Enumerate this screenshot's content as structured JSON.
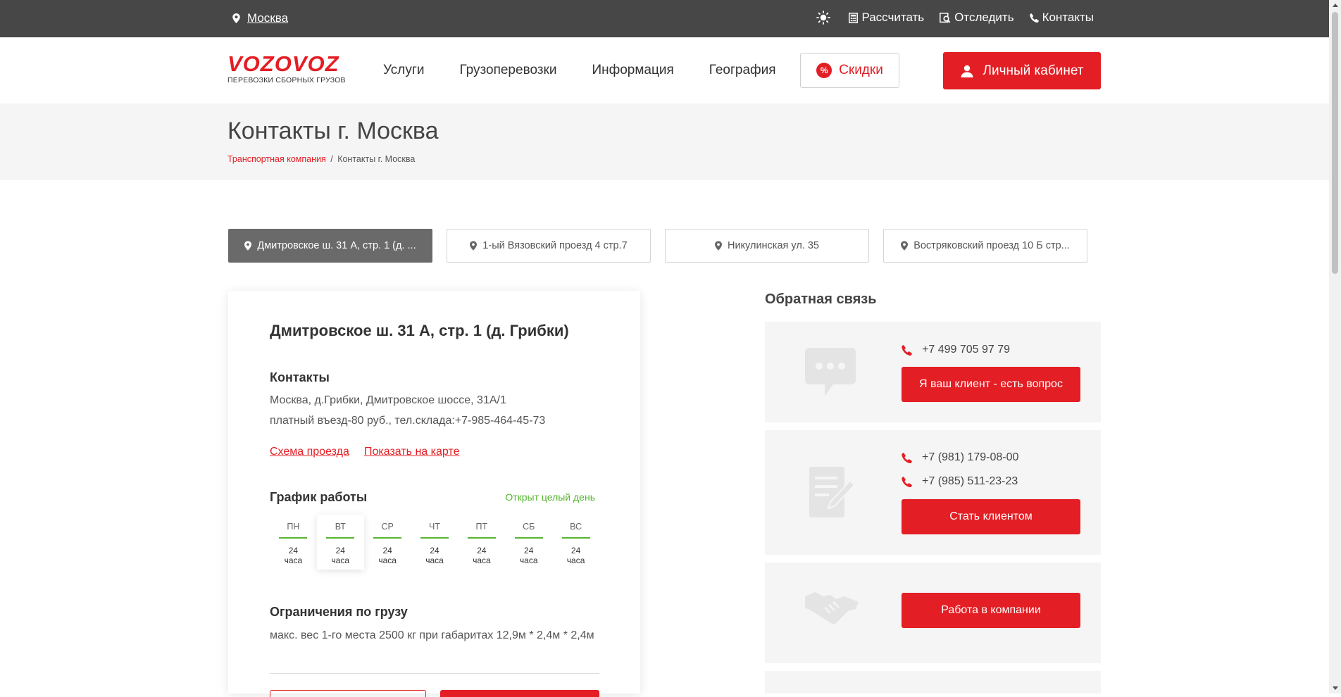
{
  "topbar": {
    "city": "Москва",
    "links": [
      {
        "label": "Рассчитать",
        "icon": "calculator-icon"
      },
      {
        "label": "Отследить",
        "icon": "track-icon"
      },
      {
        "label": "Контакты",
        "icon": "phone-icon"
      }
    ]
  },
  "logo": {
    "wordmark": "VOZOVOZ",
    "tagline": "ПЕРЕВОЗКИ СБОРНЫХ ГРУЗОВ"
  },
  "nav": [
    "Услуги",
    "Грузоперевозки",
    "Информация",
    "География"
  ],
  "discounts": {
    "label": "Скидки",
    "badge": "%"
  },
  "cabinet": {
    "label": "Личный кабинет"
  },
  "page": {
    "title": "Контакты г. Москва",
    "breadcrumb": {
      "home": "Транспортная компания",
      "separator": "/",
      "current": "Контакты г. Москва"
    }
  },
  "tabs": [
    {
      "label": "Дмитровское ш. 31 А, стр. 1 (д. ...",
      "active": true
    },
    {
      "label": "1-ый Вязовский проезд 4 стр.7",
      "active": false
    },
    {
      "label": "Никулинская ул. 35",
      "active": false
    },
    {
      "label": "Востряковский проезд 10 Б стр...",
      "active": false
    }
  ],
  "office": {
    "title": "Дмитровское ш. 31 А, стр. 1 (д. Грибки)",
    "contacts_heading": "Контакты",
    "address_line1": "Москва, д.Грибки, Дмитровское шоссе, 31А/1",
    "address_line2": "платный въезд-80 руб., тел.склада:+7-985-464-45-73",
    "link_scheme": "Схема проезда",
    "link_map": "Показать на карте",
    "schedule_heading": "График работы",
    "open_status": "Открыт целый день",
    "days": [
      {
        "day": "ПН",
        "h1": "24",
        "h2": "часа",
        "today": false
      },
      {
        "day": "ВТ",
        "h1": "24",
        "h2": "часа",
        "today": true
      },
      {
        "day": "СР",
        "h1": "24",
        "h2": "часа",
        "today": false
      },
      {
        "day": "ЧТ",
        "h1": "24",
        "h2": "часа",
        "today": false
      },
      {
        "day": "ПТ",
        "h1": "24",
        "h2": "часа",
        "today": false
      },
      {
        "day": "СБ",
        "h1": "24",
        "h2": "часа",
        "today": false
      },
      {
        "day": "ВС",
        "h1": "24",
        "h2": "часа",
        "today": false
      }
    ],
    "limits_heading": "Ограничения по грузу",
    "limits_text": "макс. вес 1-го места 2500 кг при габаритах 12,9м * 2,4м * 2,4м"
  },
  "feedback": {
    "title": "Обратная связь",
    "blocks": [
      {
        "icon": "chat-icon",
        "phones": [
          "+7 499 705 97 79"
        ],
        "button": "Я ваш клиент - есть вопрос"
      },
      {
        "icon": "document-edit-icon",
        "phones": [
          "+7 (981) 179-08-00",
          "+7 (985) 511-23-23"
        ],
        "button": "Стать клиентом"
      },
      {
        "icon": "handshake-icon",
        "phones": [],
        "button": "Работа в компании"
      }
    ]
  },
  "colors": {
    "accent": "#e31e24",
    "topbar": "#474747",
    "open": "#55b52e",
    "band": "#f5f5f5"
  }
}
